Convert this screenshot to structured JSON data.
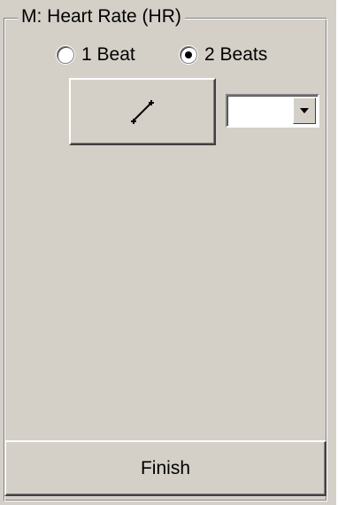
{
  "group": {
    "title": "M: Heart Rate (HR)"
  },
  "radios": [
    {
      "label": "1 Beat",
      "checked": false
    },
    {
      "label": "2 Beats",
      "checked": true
    }
  ],
  "tool_button": {
    "icon": "measure-line-icon"
  },
  "combo": {
    "value": ""
  },
  "finish": {
    "label": "Finish"
  }
}
